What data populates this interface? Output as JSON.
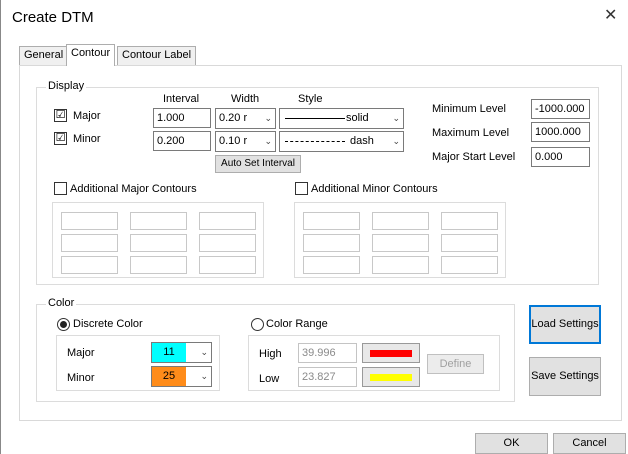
{
  "window": {
    "title": "Create DTM",
    "close_glyph": "✕"
  },
  "tabs": [
    {
      "label": "General",
      "active": false
    },
    {
      "label": "Contour",
      "active": true
    },
    {
      "label": "Contour Label",
      "active": false
    }
  ],
  "display": {
    "group_label": "Display",
    "headers": {
      "interval": "Interval",
      "width": "Width",
      "style": "Style"
    },
    "major": {
      "label": "Major",
      "checked": "☑",
      "interval": "1.000",
      "width": "0.20 r",
      "style_label": "solid"
    },
    "minor": {
      "label": "Minor",
      "checked": "☑",
      "interval": "0.200",
      "width": "0.10 r",
      "style_label": "dash"
    },
    "auto_set_interval": "Auto Set Interval",
    "minimum_level": {
      "label": "Minimum Level",
      "value": "-1000.000"
    },
    "maximum_level": {
      "label": "Maximum Level",
      "value": "1000.000"
    },
    "major_start_level": {
      "label": "Major Start Level",
      "value": "0.000"
    },
    "additional_major": "Additional Major Contours",
    "additional_minor": "Additional Minor Contours"
  },
  "color": {
    "group_label": "Color",
    "discrete": {
      "label": "Discrete Color",
      "selected": true,
      "major_label": "Major",
      "major_value": "11",
      "major_color": "#00ffff",
      "minor_label": "Minor",
      "minor_value": "25",
      "minor_color": "#ff8c1a"
    },
    "range": {
      "label": "Color Range",
      "selected": false,
      "high_label": "High",
      "high_value": "39.996",
      "high_color": "#ff0000",
      "low_label": "Low",
      "low_value": "23.827",
      "low_color": "#ffff00",
      "define_label": "Define"
    }
  },
  "buttons": {
    "load_settings": "Load Settings",
    "save_settings": "Save Settings",
    "ok": "OK",
    "cancel": "Cancel"
  },
  "icons": {
    "dropdown": "chevron-down-icon",
    "close": "close-icon",
    "checkbox_checked": "checkbox-checked-icon"
  }
}
